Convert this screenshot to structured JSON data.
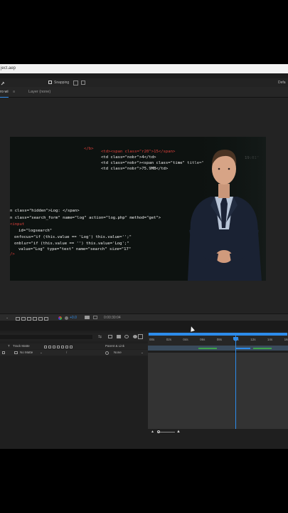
{
  "window": {
    "title_fragment": "ject.aep"
  },
  "menubar": {
    "snapping_label": "Snapping",
    "right_label": "Defa"
  },
  "panels": {
    "comp_tab": "ro wi",
    "layer_tab": "Layer (none)"
  },
  "viewer": {
    "code_lines": [
      {
        "text": "</b>",
        "tone": "red"
      },
      {
        "text": "<td><span class=\"r20\">15</span>",
        "tone": "red"
      },
      {
        "text": "<td class=\"nobr\">4</td>",
        "tone": "white"
      },
      {
        "text": "<td class=\"nobr\"><span class=\"time\" title=\"",
        "tone": "white"
      },
      {
        "text": "<td class=\"nobr\">75.9MB</td>",
        "tone": "white"
      },
      {
        "text": "n class=\"hidden\">Log: </span>",
        "tone": "white"
      },
      {
        "text": "n class=\"search_form\" name=\"log\" action=\"log.php\" method=\"get\">",
        "tone": "white"
      },
      {
        "text": "<input",
        "tone": "red"
      },
      {
        "text": "id=\"logsearch\"",
        "tone": "white"
      },
      {
        "text": "onfocus=\"if (this.value == 'Log') this.value='';\"",
        "tone": "white"
      },
      {
        "text": "onblur=\"if (this.value == '') this.value='Log';\"",
        "tone": "white"
      },
      {
        "text": "value=\"Log\" type=\"text\" name=\"search\" size=\"17\"",
        "tone": "white"
      },
      {
        "text": "/>",
        "tone": "red"
      },
      {
        "text": "19:01\"",
        "tone": "white"
      }
    ],
    "zoom": "+0.0",
    "timecode": "0:00:30:04"
  },
  "timeline": {
    "ruler_ticks": [
      "00s",
      "02s",
      "04s",
      "06s",
      "08s",
      "10s",
      "12s",
      "14s",
      "16s"
    ],
    "layer_header": {
      "track_matte": "Track Matte",
      "parent_link": "Parent & Link"
    },
    "layer_row": {
      "track_matte_value": "No Matte",
      "parent_value": "None",
      "label_t": "T"
    },
    "playhead_seconds": 10.0
  },
  "colors": {
    "accent_blue": "#2d8ceb",
    "track_green": "#3ea24a",
    "bg": "#1d1d1d"
  }
}
